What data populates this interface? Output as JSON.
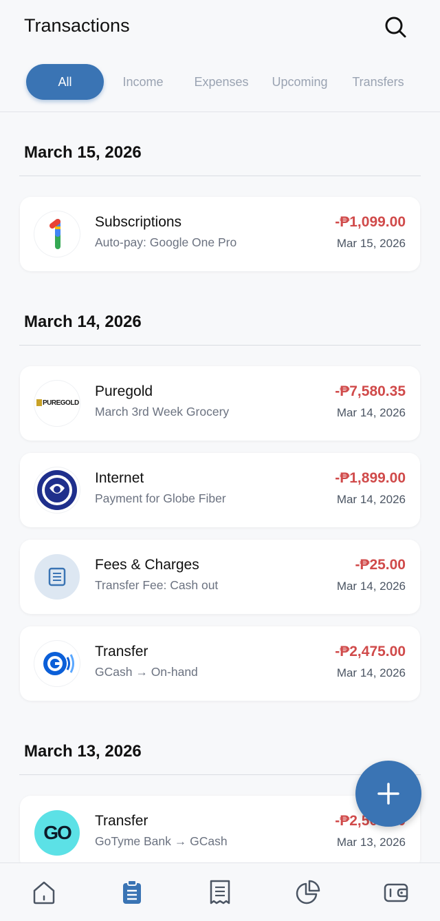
{
  "header": {
    "title": "Transactions",
    "tabs": [
      {
        "label": "All",
        "active": true
      },
      {
        "label": "Income",
        "active": false
      },
      {
        "label": "Expenses",
        "active": false
      },
      {
        "label": "Upcoming",
        "active": false
      },
      {
        "label": "Transfers",
        "active": false
      }
    ]
  },
  "sections": [
    {
      "date_label": "March 15, 2026",
      "transactions": [
        {
          "name": "Subscriptions",
          "description": "Auto-pay: Google One Pro",
          "amount": "-₱1,099.00",
          "date": "Mar 15, 2026",
          "logo": "google-one-icon"
        }
      ]
    },
    {
      "date_label": "March 14, 2026",
      "transactions": [
        {
          "name": "Puregold",
          "description": "March 3rd Week Grocery",
          "amount": "-₱7,580.35",
          "date": "Mar 14, 2026",
          "logo": "puregold-logo",
          "logo_text": "PUREGOLD"
        },
        {
          "name": "Internet",
          "description": "Payment for Globe Fiber",
          "amount": "-₱1,899.00",
          "date": "Mar 14, 2026",
          "logo": "globe-logo"
        },
        {
          "name": "Fees & Charges",
          "description": "Transfer Fee: Cash out",
          "amount": "-₱25.00",
          "date": "Mar 14, 2026",
          "logo": "receipt-icon"
        },
        {
          "name": "Transfer",
          "description": "GCash → On-hand",
          "amount": "-₱2,475.00",
          "date": "Mar 14, 2026",
          "logo": "gcash-logo"
        }
      ]
    },
    {
      "date_label": "March 13, 2026",
      "transactions": [
        {
          "name": "Transfer",
          "description": "GoTyme Bank → GCash",
          "amount": "-₱2,500.00",
          "date": "Mar 13, 2026",
          "logo": "gotyme-logo",
          "logo_text": "GO"
        }
      ]
    }
  ],
  "nav": [
    {
      "icon": "home-icon",
      "active": false
    },
    {
      "icon": "clipboard-list-icon",
      "active": true
    },
    {
      "icon": "receipt-icon",
      "active": false
    },
    {
      "icon": "pie-chart-icon",
      "active": false
    },
    {
      "icon": "wallet-icon",
      "active": false
    }
  ],
  "colors": {
    "accent": "#3a74b4",
    "expense": "#d04a4a",
    "muted": "#9aa3b2"
  }
}
